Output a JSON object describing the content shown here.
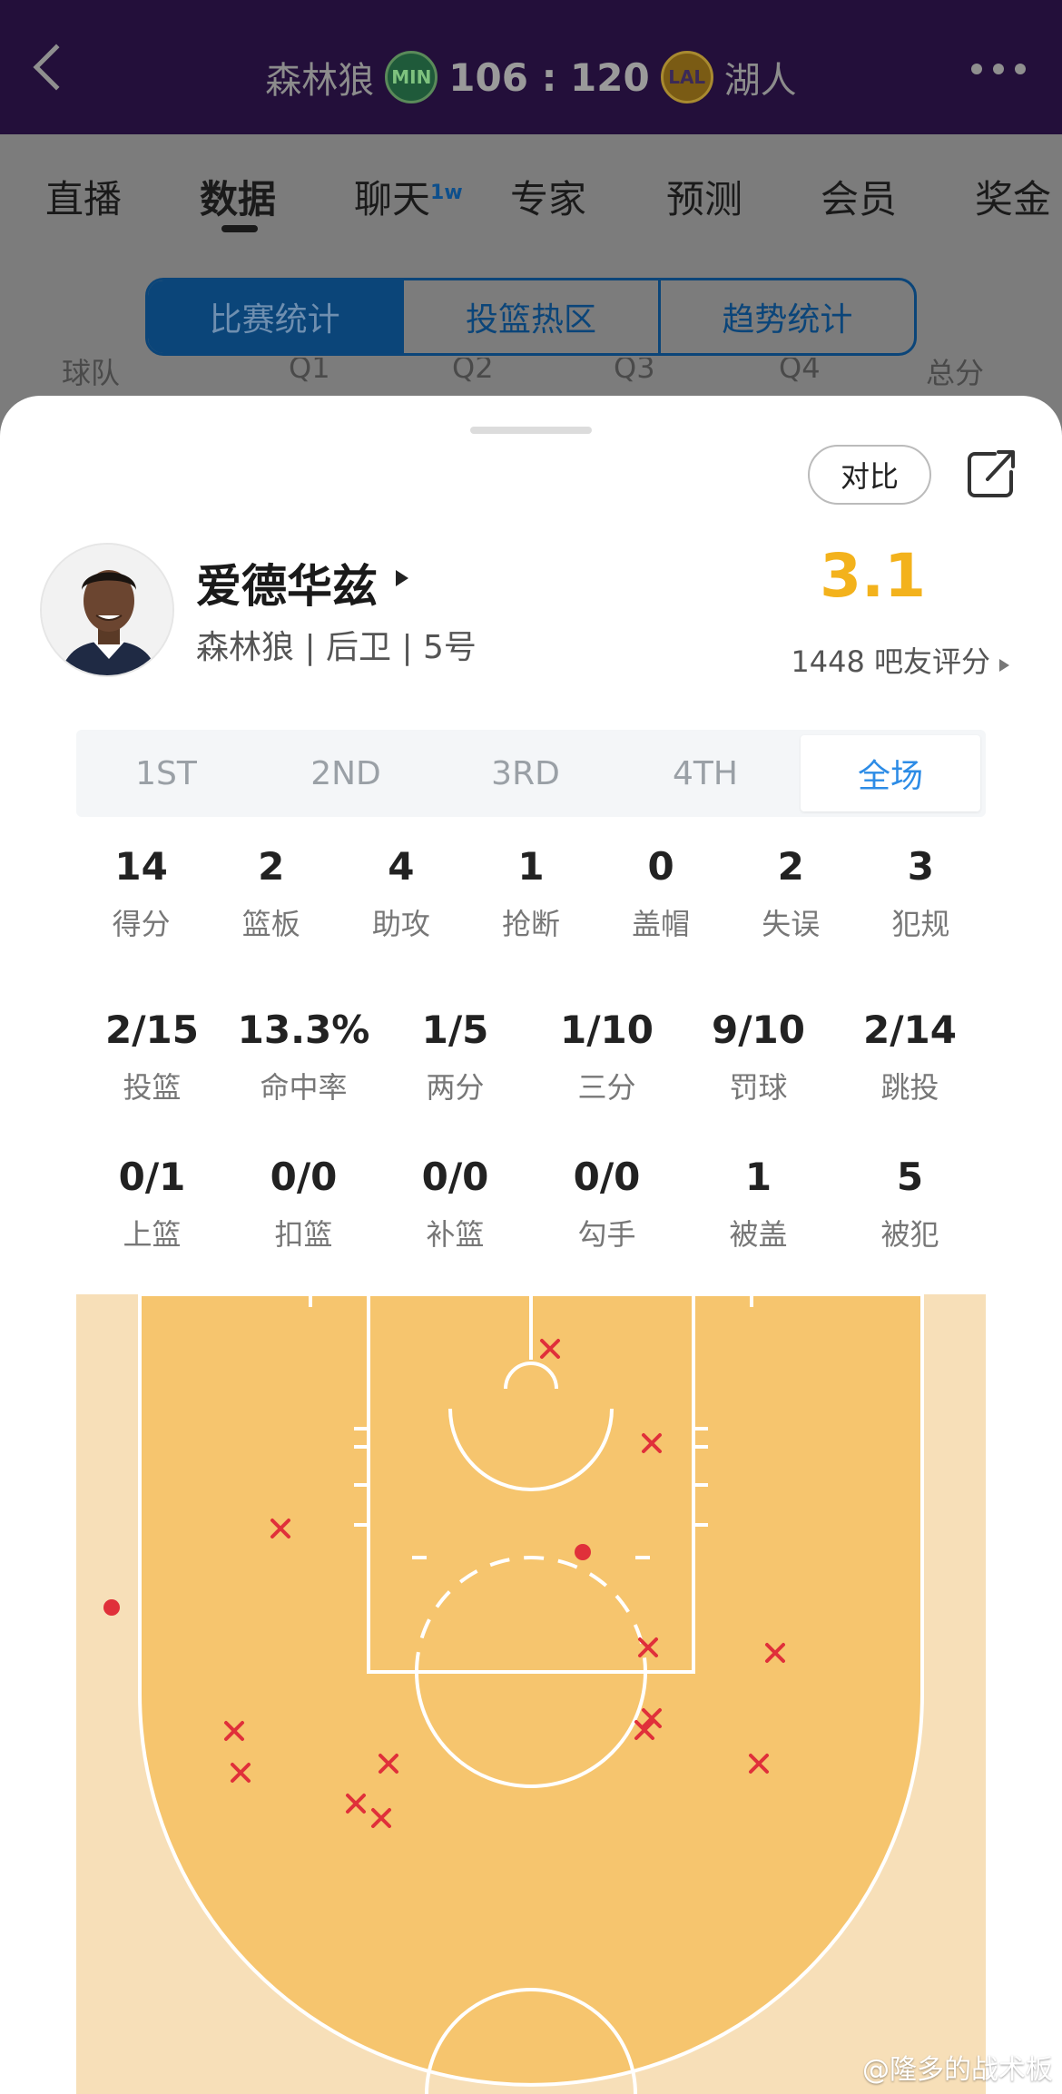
{
  "header": {
    "home_team": "森林狼",
    "home_abbr": "MIN",
    "score": "106 : 120",
    "away_abbr": "LAL",
    "away_team": "湖人"
  },
  "tabs": [
    {
      "label": "直播"
    },
    {
      "label": "数据"
    },
    {
      "label": "聊天",
      "badge": "1w"
    },
    {
      "label": "专家"
    },
    {
      "label": "预测"
    },
    {
      "label": "会员"
    },
    {
      "label": "奖金"
    }
  ],
  "segments": [
    "比赛统计",
    "投篮热区",
    "趋势统计"
  ],
  "peek_headers": [
    "球队",
    "Q1",
    "Q2",
    "Q3",
    "Q4",
    "总分"
  ],
  "sheet": {
    "compare_label": "对比",
    "player": {
      "name": "爱德华兹",
      "meta": "森林狼 | 后卫 | 5号",
      "rating": "3.1",
      "rating_count": "1448 吧友评分"
    },
    "quarters": [
      "1ST",
      "2ND",
      "3RD",
      "4TH",
      "全场"
    ],
    "active_quarter": "全场",
    "stats_row1": [
      {
        "value": "14",
        "label": "得分"
      },
      {
        "value": "2",
        "label": "篮板"
      },
      {
        "value": "4",
        "label": "助攻"
      },
      {
        "value": "1",
        "label": "抢断"
      },
      {
        "value": "0",
        "label": "盖帽"
      },
      {
        "value": "2",
        "label": "失误"
      },
      {
        "value": "3",
        "label": "犯规"
      }
    ],
    "stats_row2": [
      {
        "value": "2/15",
        "label": "投篮"
      },
      {
        "value": "13.3%",
        "label": "命中率"
      },
      {
        "value": "1/5",
        "label": "两分"
      },
      {
        "value": "1/10",
        "label": "三分"
      },
      {
        "value": "9/10",
        "label": "罚球"
      },
      {
        "value": "2/14",
        "label": "跳投"
      }
    ],
    "stats_row3": [
      {
        "value": "0/1",
        "label": "上篮"
      },
      {
        "value": "0/0",
        "label": "扣篮"
      },
      {
        "value": "0/0",
        "label": "补篮"
      },
      {
        "value": "0/0",
        "label": "勾手"
      },
      {
        "value": "1",
        "label": "被盖"
      },
      {
        "value": "5",
        "label": "被犯"
      }
    ]
  },
  "colors": {
    "court_inner": "#f6c56e",
    "court_outer": "#f7dfb8",
    "shot_mark": "#e0303a",
    "rating": "#f3b21c",
    "active_tab": "#2d8ce6"
  },
  "watermark": "@隆多的战术板"
}
